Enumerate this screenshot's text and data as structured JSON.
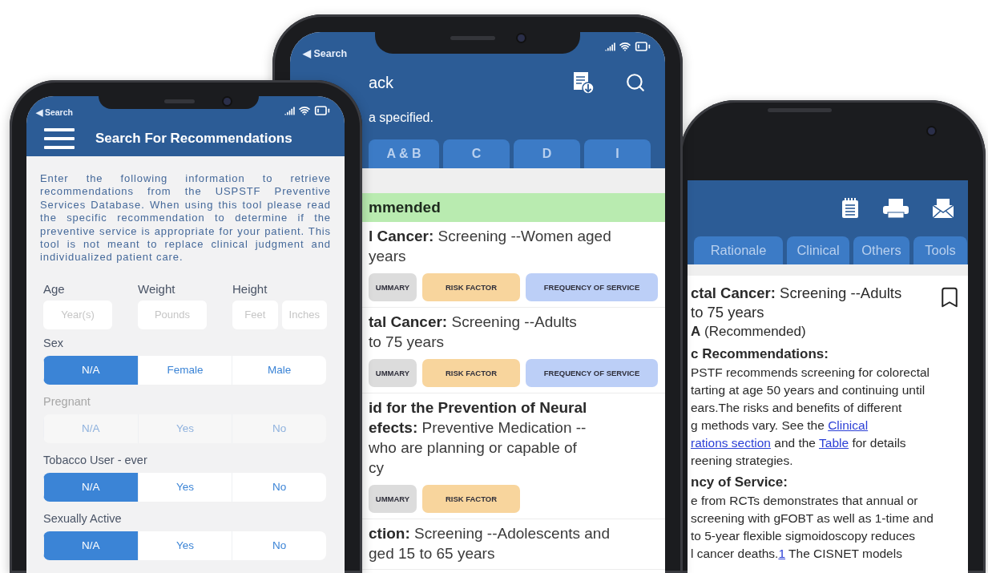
{
  "search_screen": {
    "status_back": "◀ Search",
    "title": "Search For Recommendations",
    "intro": "Enter the following information to retrieve recommendations from the USPSTF Preventive Services Database. When using this tool please read the specific recommendation to determine if the preventive service is appropriate for your patient. This tool is not meant to replace clinical judgment and individualized patient care.",
    "measurements": [
      {
        "label": "Age",
        "fields": [
          {
            "placeholder": "Year(s)"
          }
        ]
      },
      {
        "label": "Weight",
        "fields": [
          {
            "placeholder": "Pounds"
          }
        ]
      },
      {
        "label": "Height",
        "fields": [
          {
            "placeholder": "Feet"
          },
          {
            "placeholder": "Inches"
          }
        ]
      }
    ],
    "questions": [
      {
        "label": "Sex",
        "disabled": false,
        "options": [
          {
            "label": "N/A",
            "selected": true
          },
          {
            "label": "Female",
            "selected": false
          },
          {
            "label": "Male",
            "selected": false
          }
        ]
      },
      {
        "label": "Pregnant",
        "disabled": true,
        "options": [
          {
            "label": "N/A",
            "selected": false
          },
          {
            "label": "Yes",
            "selected": false
          },
          {
            "label": "No",
            "selected": false
          }
        ]
      },
      {
        "label": "Tobacco User - ever",
        "disabled": false,
        "options": [
          {
            "label": "N/A",
            "selected": true
          },
          {
            "label": "Yes",
            "selected": false
          },
          {
            "label": "No",
            "selected": false
          }
        ]
      },
      {
        "label": "Sexually Active",
        "disabled": false,
        "options": [
          {
            "label": "N/A",
            "selected": true
          },
          {
            "label": "Yes",
            "selected": false
          },
          {
            "label": "No",
            "selected": false
          }
        ]
      }
    ]
  },
  "list_screen": {
    "status_back": "◀ Search",
    "back": "ack",
    "subtitle": "a specified.",
    "tabs": [
      {
        "label": "A & B",
        "selected": false
      },
      {
        "label": "C",
        "selected": false
      },
      {
        "label": "D",
        "selected": false
      },
      {
        "label": "I",
        "selected": false
      }
    ],
    "section": "mmended",
    "items": [
      {
        "lines": [
          "**l Cancer:** Screening --Women aged",
          "years"
        ],
        "chips": [
          {
            "label": "UMMARY",
            "kind": "summary"
          },
          {
            "label": "RISK FACTOR",
            "kind": "risk"
          },
          {
            "label": "FREQUENCY OF SERVICE",
            "kind": "frequency"
          }
        ]
      },
      {
        "lines": [
          "**tal Cancer:** Screening --Adults",
          "to 75 years"
        ],
        "chips": [
          {
            "label": "UMMARY",
            "kind": "summary"
          },
          {
            "label": "RISK FACTOR",
            "kind": "risk"
          },
          {
            "label": "FREQUENCY OF SERVICE",
            "kind": "frequency"
          }
        ]
      },
      {
        "lines": [
          "**id for the Prevention of Neural**",
          "**efects:** Preventive Medication --",
          "who are planning or capable of",
          "cy"
        ],
        "chips": [
          {
            "label": "UMMARY",
            "kind": "summary"
          },
          {
            "label": "RISK FACTOR",
            "kind": "risk"
          }
        ]
      },
      {
        "lines": [
          "**ction:** Screening --Adolescents and",
          "ged 15 to 65 years"
        ]
      }
    ]
  },
  "detail_screen": {
    "tabs": [
      {
        "label": "Rationale",
        "selected": false
      },
      {
        "label": "Clinical",
        "selected": false
      },
      {
        "label": "Others",
        "selected": false
      },
      {
        "label": "Tools",
        "selected": false
      }
    ],
    "lines": [
      {
        "kind": "title",
        "segments": [
          {
            "kind": "bold",
            "text": "ctal Cancer:"
          },
          {
            "kind": "plain",
            "text": " Screening --Adults"
          }
        ]
      },
      {
        "kind": "title",
        "segments": [
          {
            "kind": "plain",
            "text": "to 75 years"
          }
        ]
      },
      {
        "kind": "grade",
        "segments": [
          {
            "kind": "bold",
            "text": "A"
          },
          {
            "kind": "plain",
            "text": " (Recommended)"
          }
        ]
      },
      {
        "kind": "section",
        "segments": [
          {
            "kind": "bold",
            "text": "c Recommendations:"
          }
        ]
      },
      {
        "kind": "body",
        "segments": [
          {
            "kind": "plain",
            "text": "PSTF recommends screening for colorectal"
          }
        ]
      },
      {
        "kind": "body",
        "segments": [
          {
            "kind": "plain",
            "text": "tarting at age 50 years and continuing until"
          }
        ]
      },
      {
        "kind": "body",
        "segments": [
          {
            "kind": "plain",
            "text": "ears.The risks and benefits of different"
          }
        ]
      },
      {
        "kind": "body",
        "segments": [
          {
            "kind": "plain",
            "text": "g methods vary. See the "
          },
          {
            "kind": "link",
            "text": "Clinical"
          }
        ]
      },
      {
        "kind": "body",
        "segments": [
          {
            "kind": "link",
            "text": "rations section"
          },
          {
            "kind": "plain",
            "text": " and the "
          },
          {
            "kind": "link",
            "text": "Table"
          },
          {
            "kind": "plain",
            "text": " for details"
          }
        ]
      },
      {
        "kind": "body",
        "segments": [
          {
            "kind": "plain",
            "text": "reening strategies."
          }
        ]
      },
      {
        "kind": "section",
        "segments": [
          {
            "kind": "bold",
            "text": "ncy of Service:"
          }
        ]
      },
      {
        "kind": "body",
        "segments": [
          {
            "kind": "plain",
            "text": "e from RCTs demonstrates that annual or"
          }
        ]
      },
      {
        "kind": "body",
        "segments": [
          {
            "kind": "plain",
            "text": "screening with gFOBT as well as 1-time and"
          }
        ]
      },
      {
        "kind": "body",
        "segments": [
          {
            "kind": "plain",
            "text": "to 5-year flexible sigmoidoscopy reduces"
          }
        ]
      },
      {
        "kind": "body",
        "segments": [
          {
            "kind": "plain",
            "text": "l cancer deaths."
          },
          {
            "kind": "link",
            "text": "1"
          },
          {
            "kind": "plain",
            "text": " The CISNET models"
          }
        ]
      }
    ]
  }
}
